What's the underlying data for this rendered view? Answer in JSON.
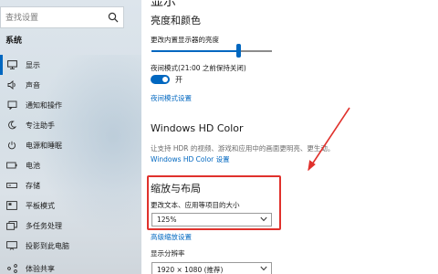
{
  "search": {
    "placeholder": "查找设置"
  },
  "sidebar": {
    "section": "系统",
    "active_index": 0,
    "items": [
      {
        "label": "显示",
        "icon": "monitor-icon"
      },
      {
        "label": "声音",
        "icon": "speaker-icon"
      },
      {
        "label": "通知和操作",
        "icon": "notification-icon"
      },
      {
        "label": "专注助手",
        "icon": "moon-icon"
      },
      {
        "label": "电源和睡眠",
        "icon": "power-icon"
      },
      {
        "label": "电池",
        "icon": "battery-icon"
      },
      {
        "label": "存储",
        "icon": "storage-icon"
      },
      {
        "label": "平板模式",
        "icon": "tablet-icon"
      },
      {
        "label": "多任务处理",
        "icon": "multitask-icon"
      },
      {
        "label": "投影到此电脑",
        "icon": "project-icon"
      },
      {
        "label": "体验共享",
        "icon": "share-icon"
      }
    ]
  },
  "main": {
    "title": "显示",
    "brightness": {
      "heading": "亮度和颜色",
      "slider_label": "更改内置显示器的亮度",
      "level": 0.72
    },
    "night_light": {
      "label": "夜间模式(21:00 之前保持关闭)",
      "state": "开",
      "settings_link": "夜间模式设置"
    },
    "hd_color": {
      "heading": "Windows HD Color",
      "description": "让支持 HDR 的视频、游戏和应用中的画面更明亮、更生动。",
      "link": "Windows HD Color 设置"
    },
    "scale_layout": {
      "heading": "缩放与布局",
      "scale_label": "更改文本、应用等项目的大小",
      "scale_value": "125%",
      "advanced_link": "高级缩放设置",
      "resolution_label": "显示分辨率",
      "resolution_value": "1920 × 1080 (推荐)"
    }
  },
  "colors": {
    "accent": "#0067c0",
    "annotation": "#e0312c"
  }
}
